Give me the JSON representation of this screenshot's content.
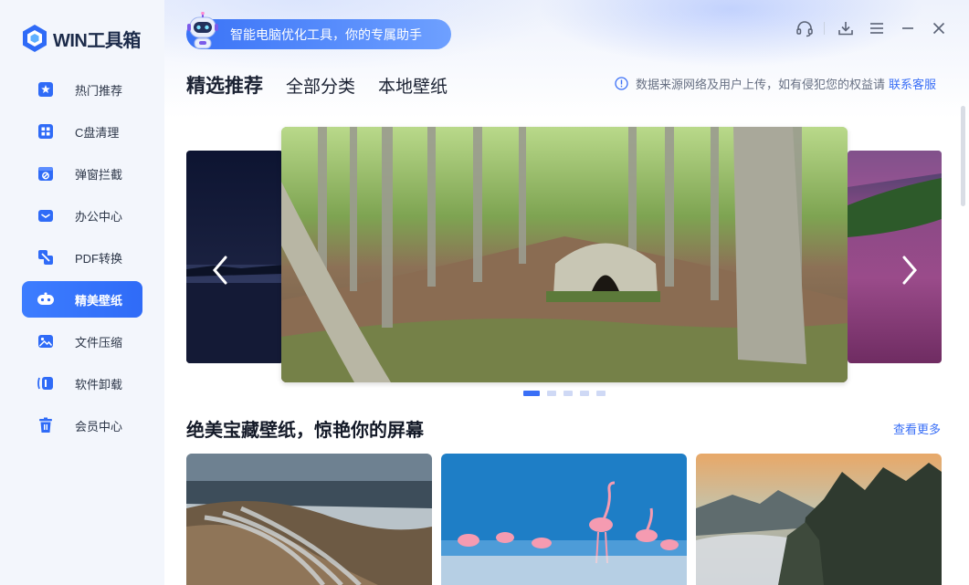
{
  "app": {
    "logo_text": "WIN工具箱",
    "banner_text": "智能电脑优化工具，你的专属助手"
  },
  "sidebar": {
    "items": [
      {
        "label": "热门推荐",
        "icon": "star-icon",
        "active": false
      },
      {
        "label": "C盘清理",
        "icon": "grid-icon",
        "active": false
      },
      {
        "label": "弹窗拦截",
        "icon": "block-icon",
        "active": false
      },
      {
        "label": "办公中心",
        "icon": "briefcase-icon",
        "active": false
      },
      {
        "label": "PDF转换",
        "icon": "convert-icon",
        "active": false
      },
      {
        "label": "精美壁纸",
        "icon": "gamepad-icon",
        "active": true
      },
      {
        "label": "文件压缩",
        "icon": "image-icon",
        "active": false
      },
      {
        "label": "软件卸载",
        "icon": "uninstall-icon",
        "active": false
      },
      {
        "label": "会员中心",
        "icon": "trash-icon",
        "active": false
      }
    ]
  },
  "header": {
    "tabs": [
      {
        "label": "精选推荐",
        "active": true
      },
      {
        "label": "全部分类",
        "active": false
      },
      {
        "label": "本地壁纸",
        "active": false
      }
    ],
    "notice_text": "数据来源网络及用户上传，如有侵犯您的权益请",
    "notice_link": "联系客服"
  },
  "window_controls": [
    "headset-icon",
    "download-icon",
    "menu-icon",
    "minimize-icon",
    "close-icon"
  ],
  "carousel": {
    "slide_count": 5,
    "active_index": 0
  },
  "section": {
    "title": "绝美宝藏壁纸，惊艳你的屏幕",
    "more_label": "查看更多"
  },
  "colors": {
    "accent": "#3a6ff6",
    "active_nav": "#2f6bf7"
  }
}
